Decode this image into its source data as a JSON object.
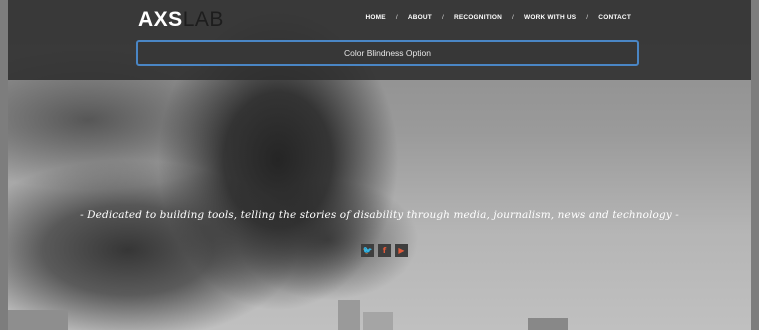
{
  "brand": {
    "logo_bold": "AXS",
    "logo_light": "LAB"
  },
  "nav": {
    "items": [
      "HOME",
      "ABOUT",
      "RECOGNITION",
      "WORK WITH US",
      "CONTACT"
    ],
    "separator": "/"
  },
  "color_option": {
    "label": "Color Blindness Option"
  },
  "hero": {
    "tagline": "- Dedicated to building tools, telling the stories of disability through media, journalism, news and technology -"
  },
  "social": {
    "icons": [
      {
        "name": "twitter-icon",
        "glyph": "🐦"
      },
      {
        "name": "facebook-icon",
        "glyph": "f"
      },
      {
        "name": "youtube-icon",
        "glyph": "▶"
      }
    ],
    "icon_color": "#e05a3a"
  },
  "colors": {
    "accent": "#4a86c5",
    "header": "#2d2d2d"
  }
}
